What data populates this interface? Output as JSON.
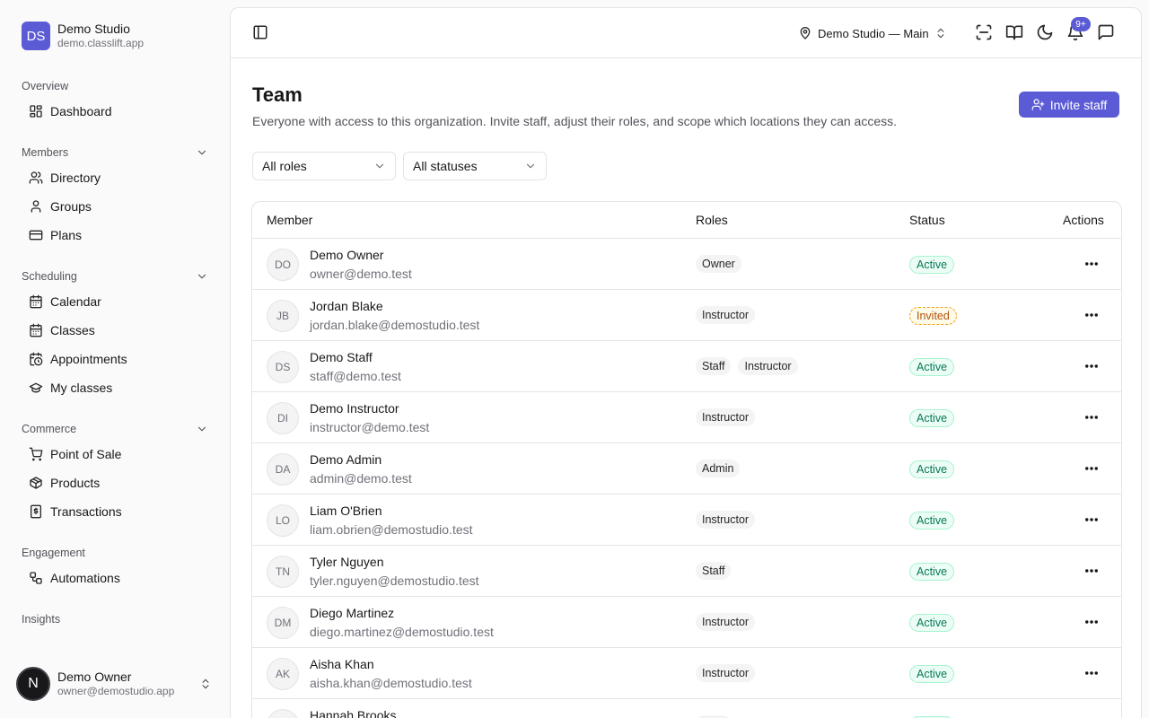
{
  "brand": {
    "logo": "DS",
    "name": "Demo Studio",
    "domain": "demo.classlift.app"
  },
  "nav": {
    "groups": [
      {
        "label": "Overview",
        "collapsible": false,
        "items": [
          {
            "label": "Dashboard",
            "icon": "dashboard-icon"
          }
        ]
      },
      {
        "label": "Members",
        "collapsible": true,
        "items": [
          {
            "label": "Directory",
            "icon": "users-icon"
          },
          {
            "label": "Groups",
            "icon": "user-icon"
          },
          {
            "label": "Plans",
            "icon": "credit-card-icon"
          }
        ]
      },
      {
        "label": "Scheduling",
        "collapsible": true,
        "items": [
          {
            "label": "Calendar",
            "icon": "calendar-icon"
          },
          {
            "label": "Classes",
            "icon": "calendar-icon"
          },
          {
            "label": "Appointments",
            "icon": "calendar-clock-icon"
          },
          {
            "label": "My classes",
            "icon": "graduation-cap-icon"
          }
        ]
      },
      {
        "label": "Commerce",
        "collapsible": true,
        "items": [
          {
            "label": "Point of Sale",
            "icon": "cart-icon"
          },
          {
            "label": "Products",
            "icon": "package-icon"
          },
          {
            "label": "Transactions",
            "icon": "receipt-icon"
          }
        ]
      },
      {
        "label": "Engagement",
        "collapsible": false,
        "items": [
          {
            "label": "Automations",
            "icon": "workflow-icon"
          }
        ]
      },
      {
        "label": "Insights",
        "collapsible": false,
        "items": []
      }
    ]
  },
  "user": {
    "avatar": "N",
    "name": "Demo Owner",
    "email": "owner@demostudio.app"
  },
  "topbar": {
    "location": "Demo Studio — Main",
    "notification_count": "9+"
  },
  "page": {
    "title": "Team",
    "subtitle": "Everyone with access to this organization. Invite staff, adjust their roles, and scope which locations they can access.",
    "invite_label": "Invite staff"
  },
  "filters": {
    "roles": "All roles",
    "statuses": "All statuses"
  },
  "table": {
    "headers": {
      "member": "Member",
      "roles": "Roles",
      "status": "Status",
      "actions": "Actions"
    },
    "rows": [
      {
        "initials": "DO",
        "name": "Demo Owner",
        "email": "owner@demo.test",
        "roles": [
          "Owner"
        ],
        "status": "Active"
      },
      {
        "initials": "JB",
        "name": "Jordan Blake",
        "email": "jordan.blake@demostudio.test",
        "roles": [
          "Instructor"
        ],
        "status": "Invited"
      },
      {
        "initials": "DS",
        "name": "Demo Staff",
        "email": "staff@demo.test",
        "roles": [
          "Staff",
          "Instructor"
        ],
        "status": "Active"
      },
      {
        "initials": "DI",
        "name": "Demo Instructor",
        "email": "instructor@demo.test",
        "roles": [
          "Instructor"
        ],
        "status": "Active"
      },
      {
        "initials": "DA",
        "name": "Demo Admin",
        "email": "admin@demo.test",
        "roles": [
          "Admin"
        ],
        "status": "Active"
      },
      {
        "initials": "LO",
        "name": "Liam O'Brien",
        "email": "liam.obrien@demostudio.test",
        "roles": [
          "Instructor"
        ],
        "status": "Active"
      },
      {
        "initials": "TN",
        "name": "Tyler Nguyen",
        "email": "tyler.nguyen@demostudio.test",
        "roles": [
          "Staff"
        ],
        "status": "Active"
      },
      {
        "initials": "DM",
        "name": "Diego Martinez",
        "email": "diego.martinez@demostudio.test",
        "roles": [
          "Instructor"
        ],
        "status": "Active"
      },
      {
        "initials": "AK",
        "name": "Aisha Khan",
        "email": "aisha.khan@demostudio.test",
        "roles": [
          "Instructor"
        ],
        "status": "Active"
      },
      {
        "initials": "HB",
        "name": "Hannah Brooks",
        "email": "",
        "roles": [
          "Staff"
        ],
        "status": "Active"
      }
    ]
  },
  "colors": {
    "accent": "#5b5bd6",
    "active": "#047857",
    "invited": "#b45309"
  }
}
